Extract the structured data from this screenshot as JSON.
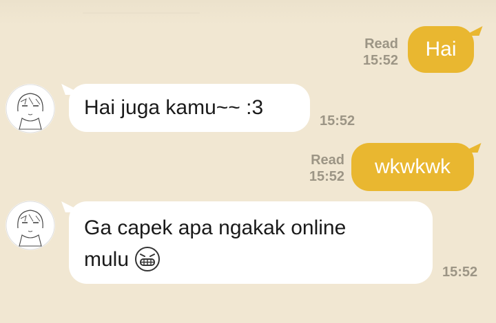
{
  "messages": [
    {
      "direction": "out",
      "text": "Hai",
      "status": "Read",
      "time": "15:52"
    },
    {
      "direction": "in",
      "text": "Hai juga kamu~~ :3",
      "time": "15:52",
      "avatar": "anime-girl-sketch-avatar"
    },
    {
      "direction": "out",
      "text": "wkwkwk",
      "status": "Read",
      "time": "15:52"
    },
    {
      "direction": "in",
      "text_line1": "Ga capek apa ngakak online",
      "text_line2": "mulu",
      "emoji": "grinning-face-emoji",
      "time": "15:52",
      "avatar": "anime-girl-sketch-avatar"
    }
  ],
  "colors": {
    "background": "#f1e7d2",
    "outgoing_bubble": "#e9b730",
    "incoming_bubble": "#ffffff",
    "meta_text": "#9c9585"
  }
}
